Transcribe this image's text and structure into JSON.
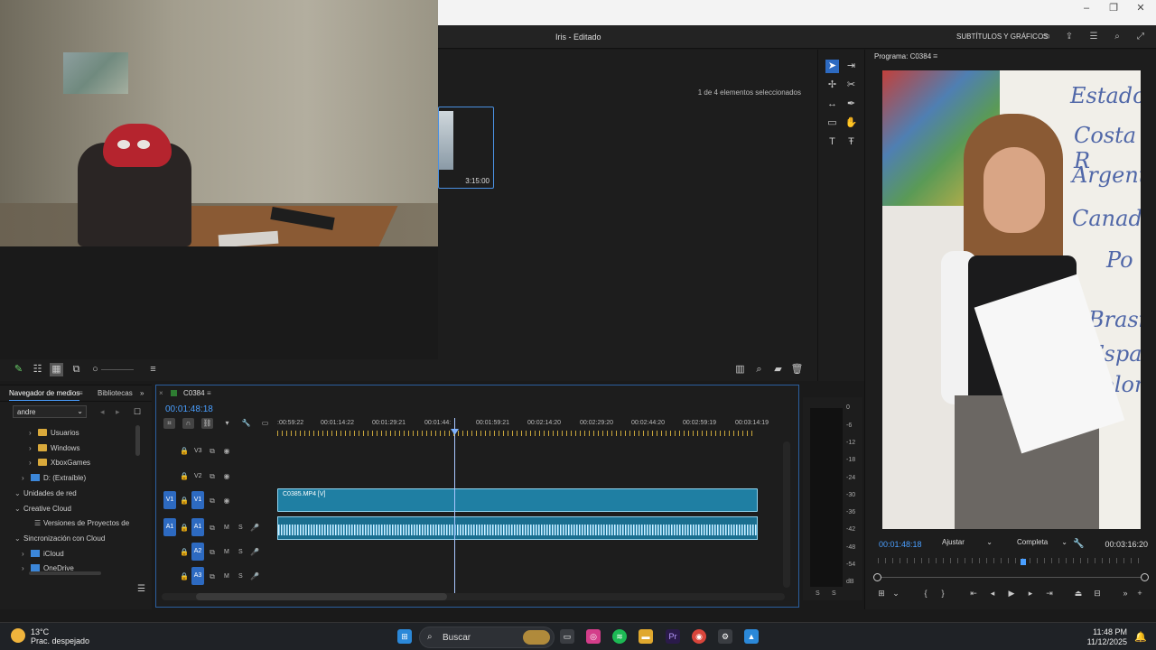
{
  "app": {
    "title": "Iris - Editado",
    "header_label": "SUBTÍTULOS Y GRÁFICOS"
  },
  "project": {
    "selection_status": "1 de 4 elementos seleccionados",
    "thumb_duration": "3:15:00"
  },
  "media_browser": {
    "tabs": [
      "Navegador de medios",
      "Bibliotecas"
    ],
    "search_value": "andre",
    "items": [
      "Usuarios",
      "Windows",
      "XboxGames",
      "D: (Extraíble)",
      "Unidades de red",
      "Creative Cloud",
      "Versiones de Proyectos de",
      "Sincronización con Cloud",
      "iCloud",
      "OneDrive"
    ]
  },
  "timeline": {
    "sequence_name": "C0384",
    "timecode": "00:01:48:18",
    "ruler_labels": [
      ":00:59:22",
      "00:01:14:22",
      "00:01:29:21",
      "00:01:44:",
      "00:01:59:21",
      "00:02:14:20",
      "00:02:29:20",
      "00:02:44:20",
      "00:02:59:19",
      "00:03:14:19"
    ],
    "tracks": {
      "v3": "V3",
      "v2": "V2",
      "v1": "V1",
      "a1": "A1",
      "a2": "A2",
      "a3": "A3",
      "mute": "M",
      "solo": "S"
    },
    "video_clip_name": "C0385.MP4 [V]",
    "playhead_fraction": 0.368
  },
  "meters": {
    "labels": [
      "0",
      "-6",
      "-12",
      "-18",
      "-24",
      "-30",
      "-36",
      "-42",
      "-48",
      "-54",
      "dB"
    ],
    "solo_labels": [
      "S",
      "S"
    ]
  },
  "program_monitor": {
    "title": "Programa: C0384",
    "timecode": "00:01:48:18",
    "fit": "Ajustar",
    "quality": "Completa",
    "duration": "00:03:16:20",
    "whiteboard_words": [
      "Estados",
      "Costa R",
      "Argentin",
      "Canadá",
      "Po",
      "Brasi",
      "Espa",
      "Colom"
    ]
  },
  "taskbar": {
    "temperature": "13°C",
    "weather": "Prac. despejado",
    "search_label": "Buscar",
    "time": "11:48 PM",
    "date": "11/12/2025"
  },
  "colors": {
    "accent_blue": "#4a9fff",
    "clip_video": "#1f7fa3",
    "clip_audio": "#1a6e8f",
    "track_target": "#2d6ac1"
  }
}
